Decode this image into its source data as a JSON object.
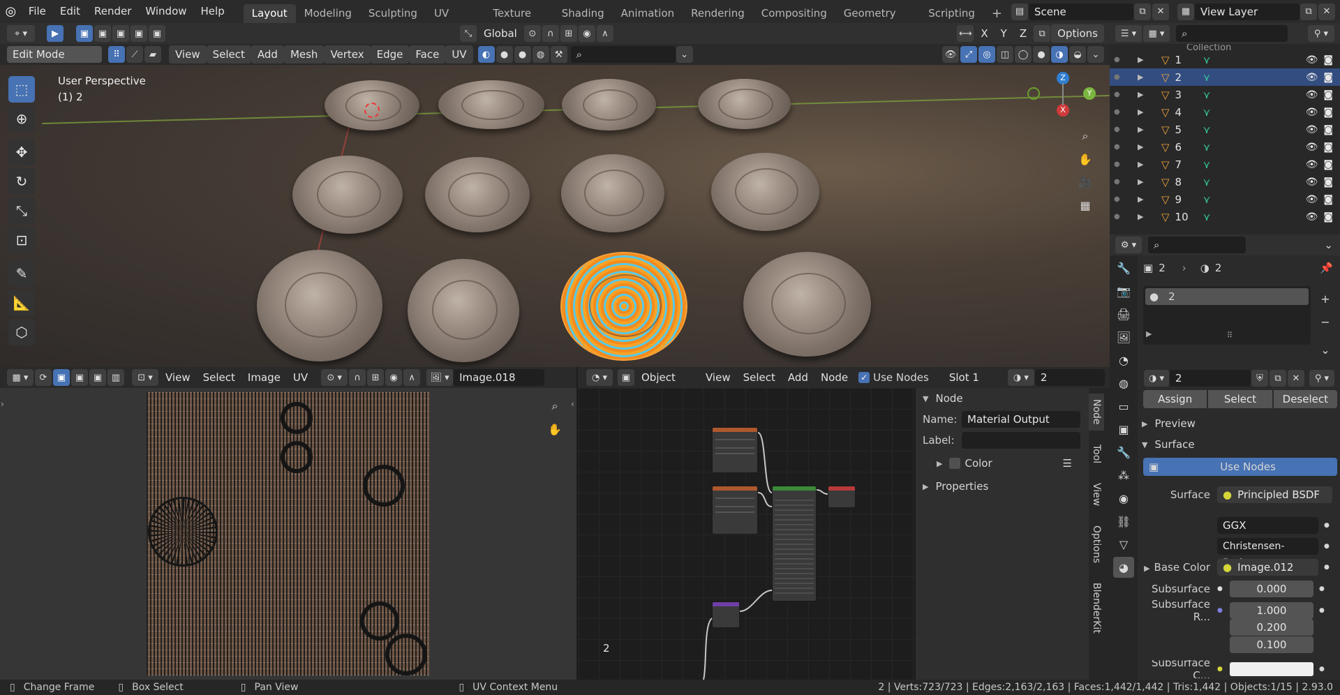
{
  "topbar": {
    "menus": [
      "File",
      "Edit",
      "Render",
      "Window",
      "Help"
    ],
    "workspaces": [
      "Layout",
      "Modeling",
      "Sculpting",
      "UV Editing",
      "Texture Paint",
      "Shading",
      "Animation",
      "Rendering",
      "Compositing",
      "Geometry Nodes",
      "Scripting"
    ],
    "active_workspace": "Layout",
    "scene": "Scene",
    "view_layer": "View Layer"
  },
  "viewport_header": {
    "mode": "Edit Mode",
    "menus": [
      "View",
      "Select",
      "Add",
      "Mesh",
      "Vertex",
      "Edge",
      "Face",
      "UV"
    ],
    "orientation": "Global",
    "options": "Options"
  },
  "viewport": {
    "perspective": "User Perspective",
    "object_info": "(1) 2",
    "gizmo": {
      "x": "X",
      "y": "Y",
      "z": "Z"
    }
  },
  "uv_editor": {
    "menus": [
      "View",
      "Select",
      "Image",
      "UV"
    ],
    "image_name": "Image.018"
  },
  "node_editor": {
    "type": "Object",
    "menus": [
      "View",
      "Select",
      "Add",
      "Node"
    ],
    "use_nodes_label": "Use Nodes",
    "slot": "Slot 1",
    "material": "2",
    "corner_label": "2",
    "n_panel": {
      "section": "Node",
      "name_label": "Name:",
      "name_value": "Material Output",
      "label_label": "Label:",
      "label_value": "",
      "color": "Color",
      "properties": "Properties"
    },
    "tabs": [
      "Node",
      "Tool",
      "View",
      "Options",
      "BlenderKit"
    ]
  },
  "outliner": {
    "collection": "Collection",
    "items": [
      "1",
      "2",
      "3",
      "4",
      "5",
      "6",
      "7",
      "8",
      "9",
      "10"
    ],
    "selected": "2"
  },
  "properties": {
    "object_name": "2",
    "material_name": "2",
    "slot_item": "2",
    "material_field": "2",
    "buttons": [
      "Assign",
      "Select",
      "Deselect"
    ],
    "preview": "Preview",
    "surface_section": "Surface",
    "use_nodes": "Use Nodes",
    "surface_label": "Surface",
    "surface_value": "Principled BSDF",
    "distribution": "GGX",
    "subsurface_method": "Christensen-Burley",
    "base_color_label": "Base Color",
    "base_color_value": "Image.012",
    "subsurface_label": "Subsurface",
    "subsurface_value": "0.000",
    "subsurface_radius_label": "Subsurface R...",
    "subsurface_radius": [
      "1.000",
      "0.200",
      "0.100"
    ],
    "subsurface_color_label": "Subsurface C..."
  },
  "statusbar": {
    "left": [
      "Change Frame",
      "Box Select",
      "Pan View",
      "UV Context Menu"
    ],
    "right": "2 | Verts:723/723 | Edges:2,163/2,163 | Faces:1,442/1,442 | Tris:1,442 | Objects:1/15 | 2.93.0"
  },
  "colors": {
    "accent": "#4772b3",
    "selected_row": "#334d80",
    "header": "#303030",
    "panel": "#2b2b2b"
  }
}
